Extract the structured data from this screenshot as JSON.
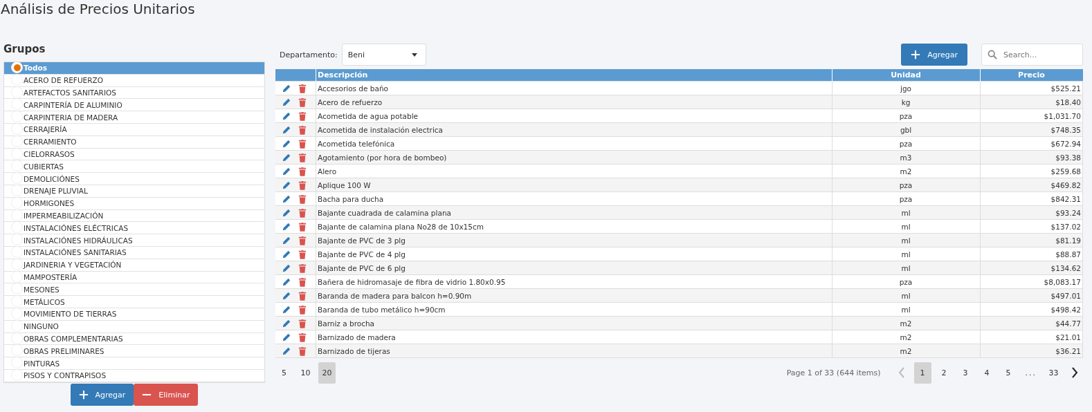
{
  "title": "Análisis de Precios Unitarios",
  "groups": {
    "heading": "Grupos",
    "items": [
      {
        "label": "Todos",
        "selected": true
      },
      {
        "label": "ACERO DE REFUERZO",
        "selected": false
      },
      {
        "label": "ARTEFACTOS SANITARIOS",
        "selected": false
      },
      {
        "label": "CARPINTERÍA DE ALUMINIO",
        "selected": false
      },
      {
        "label": "CARPINTERIA DE MADERA",
        "selected": false
      },
      {
        "label": "CERRAJERÍA",
        "selected": false
      },
      {
        "label": "CERRAMIENTO",
        "selected": false
      },
      {
        "label": "CIELORRASOS",
        "selected": false
      },
      {
        "label": "CUBIERTAS",
        "selected": false
      },
      {
        "label": "DEMOLICIÓNES",
        "selected": false
      },
      {
        "label": "DRENAJE PLUVIAL",
        "selected": false
      },
      {
        "label": "HORMIGONES",
        "selected": false
      },
      {
        "label": "IMPERMEABILIZACIÓN",
        "selected": false
      },
      {
        "label": "INSTALACIÓNES ELÉCTRICAS",
        "selected": false
      },
      {
        "label": "INSTALACIÓNES HIDRÁULICAS",
        "selected": false
      },
      {
        "label": "INSTALACIÓNES SANITARIAS",
        "selected": false
      },
      {
        "label": "JARDINERIA Y VEGETACIÓN",
        "selected": false
      },
      {
        "label": "MAMPOSTERÍA",
        "selected": false
      },
      {
        "label": "MESONES",
        "selected": false
      },
      {
        "label": "METÁLICOS",
        "selected": false
      },
      {
        "label": "MOVIMIENTO DE TIERRAS",
        "selected": false
      },
      {
        "label": "NINGUNO",
        "selected": false
      },
      {
        "label": "OBRAS COMPLEMENTARIAS",
        "selected": false
      },
      {
        "label": "OBRAS PRELIMINARES",
        "selected": false
      },
      {
        "label": "PINTURAS",
        "selected": false
      },
      {
        "label": "PISOS Y CONTRAPISOS",
        "selected": false
      }
    ],
    "buttons": [
      {
        "label": "Agregar",
        "kind": "add"
      },
      {
        "label": "Eliminar",
        "kind": "remove"
      }
    ]
  },
  "toolbar": {
    "department_label": "Departamento:",
    "department": {
      "value": "Beni"
    },
    "add_button": "Agregar",
    "search": {
      "placeholder": "Search..."
    }
  },
  "table": {
    "columns": [
      "Descripción",
      "Unidad",
      "Precio"
    ],
    "rows": [
      {
        "description": "Accesorios de baño",
        "unit": "jgo",
        "price": "$525.21"
      },
      {
        "description": "Acero de refuerzo",
        "unit": "kg",
        "price": "$18.40"
      },
      {
        "description": "Acometida de agua potable",
        "unit": "pza",
        "price": "$1,031.70"
      },
      {
        "description": "Acometida de instalación electrica",
        "unit": "gbl",
        "price": "$748.35"
      },
      {
        "description": "Acometida telefónica",
        "unit": "pza",
        "price": "$672.94"
      },
      {
        "description": "Agotamiento (por hora de bombeo)",
        "unit": "m3",
        "price": "$93.38"
      },
      {
        "description": "Alero",
        "unit": "m2",
        "price": "$259.68"
      },
      {
        "description": "Aplique 100 W",
        "unit": "pza",
        "price": "$469.82"
      },
      {
        "description": "Bacha para ducha",
        "unit": "pza",
        "price": "$842.31"
      },
      {
        "description": "Bajante cuadrada de calamina plana",
        "unit": "ml",
        "price": "$93.24"
      },
      {
        "description": "Bajante de calamina plana No28 de 10x15cm",
        "unit": "ml",
        "price": "$137.02"
      },
      {
        "description": "Bajante de PVC de 3 plg",
        "unit": "ml",
        "price": "$81.19"
      },
      {
        "description": "Bajante de PVC de 4 plg",
        "unit": "ml",
        "price": "$88.87"
      },
      {
        "description": "Bajante de PVC de 6 plg",
        "unit": "ml",
        "price": "$134.62"
      },
      {
        "description": "Bañera de hidromasaje de fibra de vidrio 1.80x0.95",
        "unit": "pza",
        "price": "$8,083.17"
      },
      {
        "description": "Baranda de madera para balcon h=0.90m",
        "unit": "ml",
        "price": "$497.01"
      },
      {
        "description": "Baranda de tubo metálico h=90cm",
        "unit": "ml",
        "price": "$498.42"
      },
      {
        "description": "Barniz a brocha",
        "unit": "m2",
        "price": "$44.77"
      },
      {
        "description": "Barnizado de madera",
        "unit": "m2",
        "price": "$21.01"
      },
      {
        "description": "Barnizado de tijeras",
        "unit": "m2",
        "price": "$36.21"
      }
    ]
  },
  "pager": {
    "page_sizes": [
      {
        "label": "5",
        "selected": false
      },
      {
        "label": "10",
        "selected": false
      },
      {
        "label": "20",
        "selected": true
      }
    ],
    "summary": "Page 1 of 33 (644 items)",
    "prev": {
      "disabled": true
    },
    "next": {
      "disabled": false
    },
    "pages": [
      {
        "label": "1",
        "kind": "page",
        "selected": true
      },
      {
        "label": "2",
        "kind": "page",
        "selected": false
      },
      {
        "label": "3",
        "kind": "page",
        "selected": false
      },
      {
        "label": "4",
        "kind": "page",
        "selected": false
      },
      {
        "label": "5",
        "kind": "page",
        "selected": false
      },
      {
        "label": "...",
        "kind": "ellipsis"
      },
      {
        "label": "33",
        "kind": "page",
        "selected": false
      }
    ]
  }
}
